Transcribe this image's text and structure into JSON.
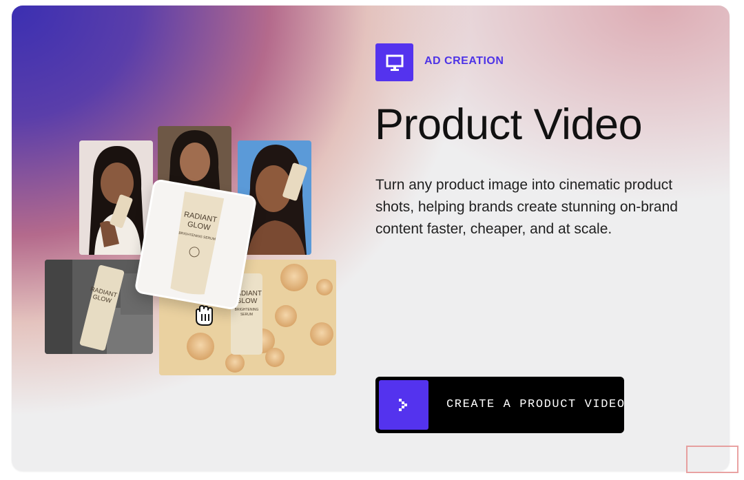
{
  "card": {
    "eyebrow": "AD CREATION",
    "title": "Product Video",
    "description": "Turn any product image into cinematic product shots, helping brands create stunning on-brand content faster, cheaper, and at scale.",
    "badge_icon": "monitor-icon",
    "cta": {
      "label": "CREATE A PRODUCT VIDEO",
      "icon": "chevron-right-icon"
    }
  },
  "product": {
    "brand_line1": "RADIANT",
    "brand_line2": "GLOW",
    "subtitle": "BRIGHTENING SERUM"
  },
  "colors": {
    "accent": "#5433ee",
    "accent_text": "#4d33e6",
    "cta_background": "#000000",
    "title": "#111111"
  }
}
